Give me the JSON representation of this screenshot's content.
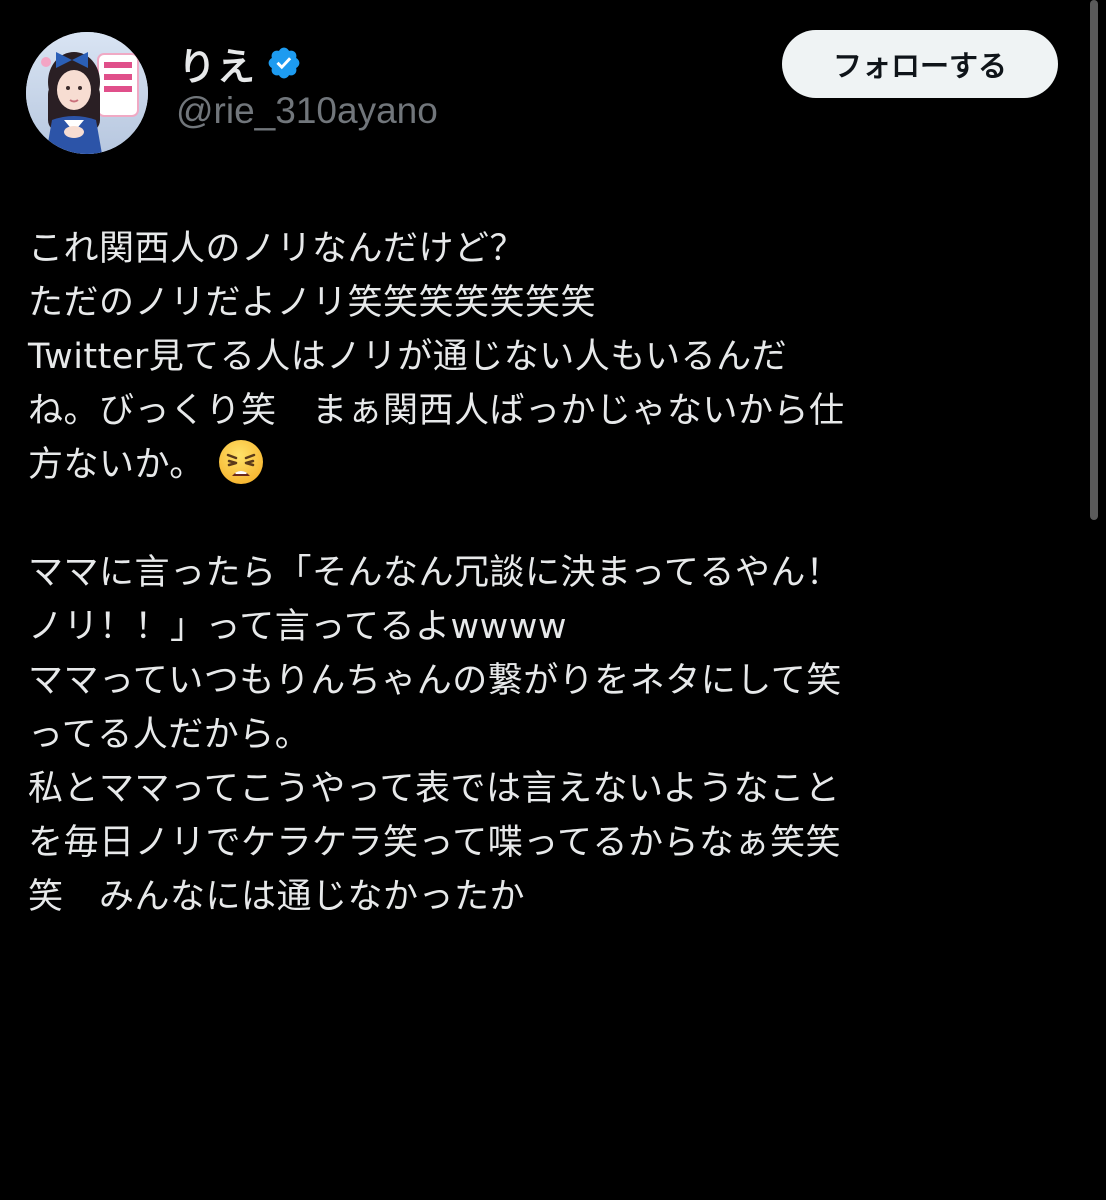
{
  "user": {
    "display_name": "りえ",
    "handle": "@rie_310ayano",
    "verified": true,
    "verified_color": "#1d9bf0",
    "avatar_icon": "profile-photo"
  },
  "follow_button": {
    "label": "フォローする"
  },
  "tweet": {
    "paragraph1": [
      "これ関西人のノリなんだけど？",
      "ただのノリだよノリ笑笑笑笑笑笑笑",
      "Twitter見てる人はノリが通じない人もいるんだ",
      "ね。びっくり笑　まぁ関西人ばっかじゃないから仕",
      "方ないか。"
    ],
    "paragraph1_emoji": "weary-face-emoji",
    "paragraph2": [
      "ママに言ったら「そんなん冗談に決まってるやん！",
      "ノリ！！」って言ってるよwwww",
      "ママっていつもりんちゃんの繋がりをネタにして笑",
      "ってる人だから。",
      "私とママってこうやって表では言えないようなこと",
      "を毎日ノリでケラケラ笑って喋ってるからなぁ笑笑",
      "笑　みんなには通じなかったか"
    ]
  },
  "colors": {
    "background": "#000000",
    "text_primary": "#e7e9ea",
    "text_secondary": "#71767b",
    "button_bg": "#eff3f4"
  }
}
